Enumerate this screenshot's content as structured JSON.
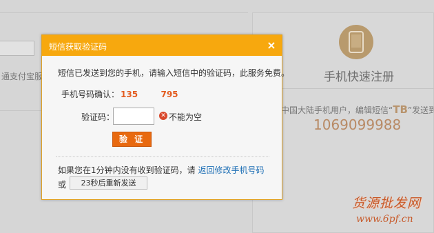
{
  "background": {
    "left_text": "通支付宝服务",
    "register_title": "手机快速注册",
    "sms_hint_prefix": "中国大陆手机用户，编辑短信“",
    "sms_hint_keyword": "TB",
    "sms_hint_suffix": "”发送到：",
    "sms_number": "1069099988",
    "watermark_top": "货源批发网",
    "watermark_bottom": "www.6pf.cn"
  },
  "dialog": {
    "title": "短信获取验证码",
    "close_symbol": "×",
    "notice": "短信已发送到您的手机，请输入短信中的验证码，此服务免费。",
    "phone_label": "手机号码确认：",
    "phone_value": "135        795",
    "code_label": "验证码：",
    "code_value": "",
    "error_text": "不能为空",
    "verify_label": "验 证",
    "resend_prefix": "如果您在1分钟内没有收到验证码，请 ",
    "resend_link": "返回修改手机号码",
    "or_label": "或",
    "resend_button": "23秒后重新发送"
  },
  "colors": {
    "header": "#f7a80e",
    "verify_button": "#e8690f",
    "phone_value": "#e35b1f",
    "link": "#1e6fb5",
    "error": "#d9472b"
  },
  "icons": {
    "close": "close-icon",
    "error": "error-icon",
    "phone": "mobile-phone-icon"
  }
}
